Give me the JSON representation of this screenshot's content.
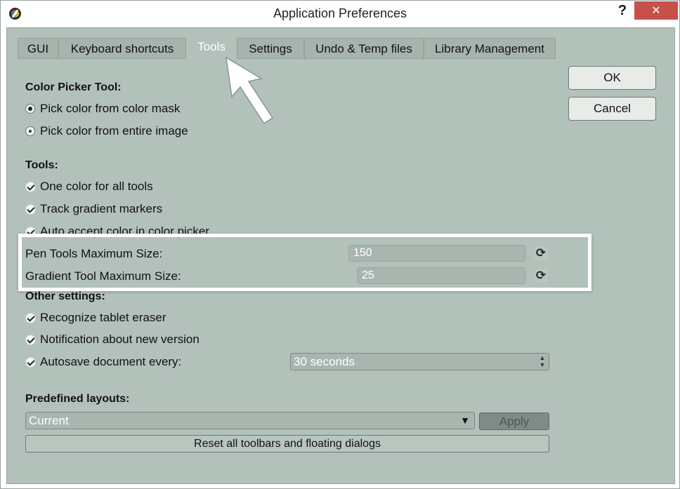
{
  "window": {
    "title": "Application Preferences",
    "help": "?",
    "close": "✕"
  },
  "tabs": [
    {
      "label": "GUI"
    },
    {
      "label": "Keyboard shortcuts"
    },
    {
      "label": "Tools"
    },
    {
      "label": "Settings"
    },
    {
      "label": "Undo & Temp files"
    },
    {
      "label": "Library Management"
    }
  ],
  "active_tab": "Tools",
  "actions": {
    "ok": "OK",
    "cancel": "Cancel"
  },
  "color_picker": {
    "title": "Color Picker Tool:",
    "options": [
      {
        "label": "Pick color from color mask",
        "selected": true
      },
      {
        "label": "Pick color from entire image",
        "selected": false
      }
    ]
  },
  "tools": {
    "title": "Tools:",
    "checks": [
      {
        "label": "One color for all tools",
        "checked": true
      },
      {
        "label": "Track gradient markers",
        "checked": true
      },
      {
        "label": "Auto accept color in color picker",
        "checked": true
      }
    ],
    "pen_label": "Pen Tools Maximum Size:",
    "pen_value": "150",
    "gradient_label": "Gradient Tool Maximum Size:",
    "gradient_value": "25"
  },
  "other": {
    "title": "Other settings:",
    "checks": [
      {
        "label": "Recognize tablet eraser",
        "checked": true
      },
      {
        "label": "Notification about new version",
        "checked": true
      },
      {
        "label": "Autosave document every:",
        "checked": true
      }
    ],
    "autosave_value": "30 seconds"
  },
  "layouts": {
    "title": "Predefined layouts:",
    "current": "Current",
    "apply": "Apply",
    "reset": "Reset all toolbars and floating dialogs"
  }
}
